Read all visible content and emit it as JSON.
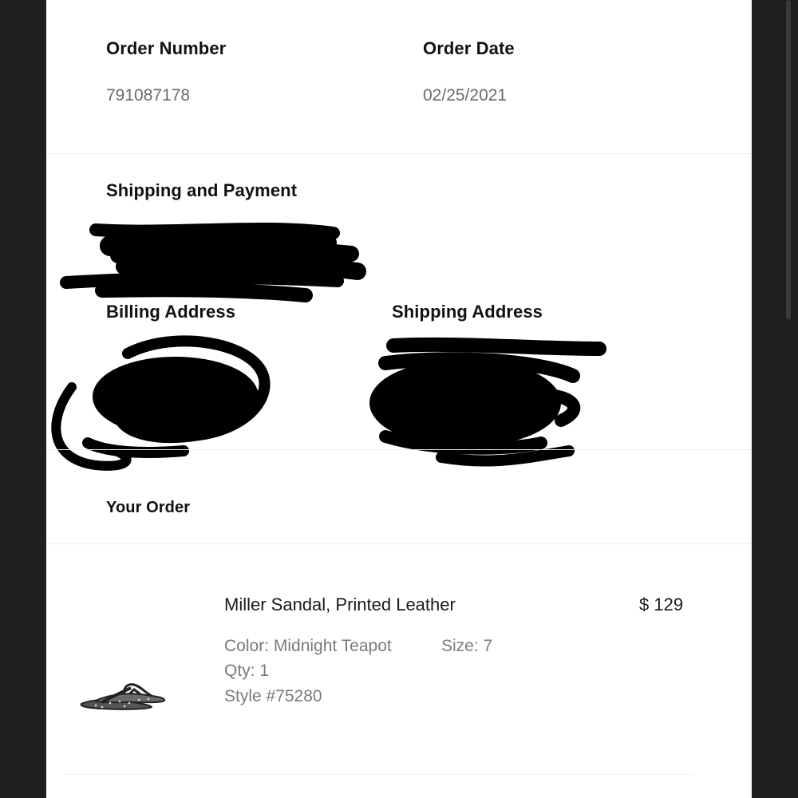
{
  "order_info": {
    "order_number_label": "Order Number",
    "order_number_value": "791087178",
    "order_date_label": "Order Date",
    "order_date_value": "02/25/2021"
  },
  "shipping_payment": {
    "title": "Shipping and Payment",
    "billing_address_label": "Billing Address",
    "shipping_address_label": "Shipping Address"
  },
  "your_order": {
    "title": "Your Order",
    "items": [
      {
        "name": "Miller Sandal, Printed Leather",
        "price": "$ 129",
        "color": "Color: Midnight Teapot",
        "size": "Size: 7",
        "qty": "Qty: 1",
        "style": "Style #75280",
        "image_icon": "sandal-product-image"
      }
    ]
  },
  "colors": {
    "page_background": "#ffffff",
    "bezel": "#1e1e1e",
    "redaction": "#000000"
  }
}
